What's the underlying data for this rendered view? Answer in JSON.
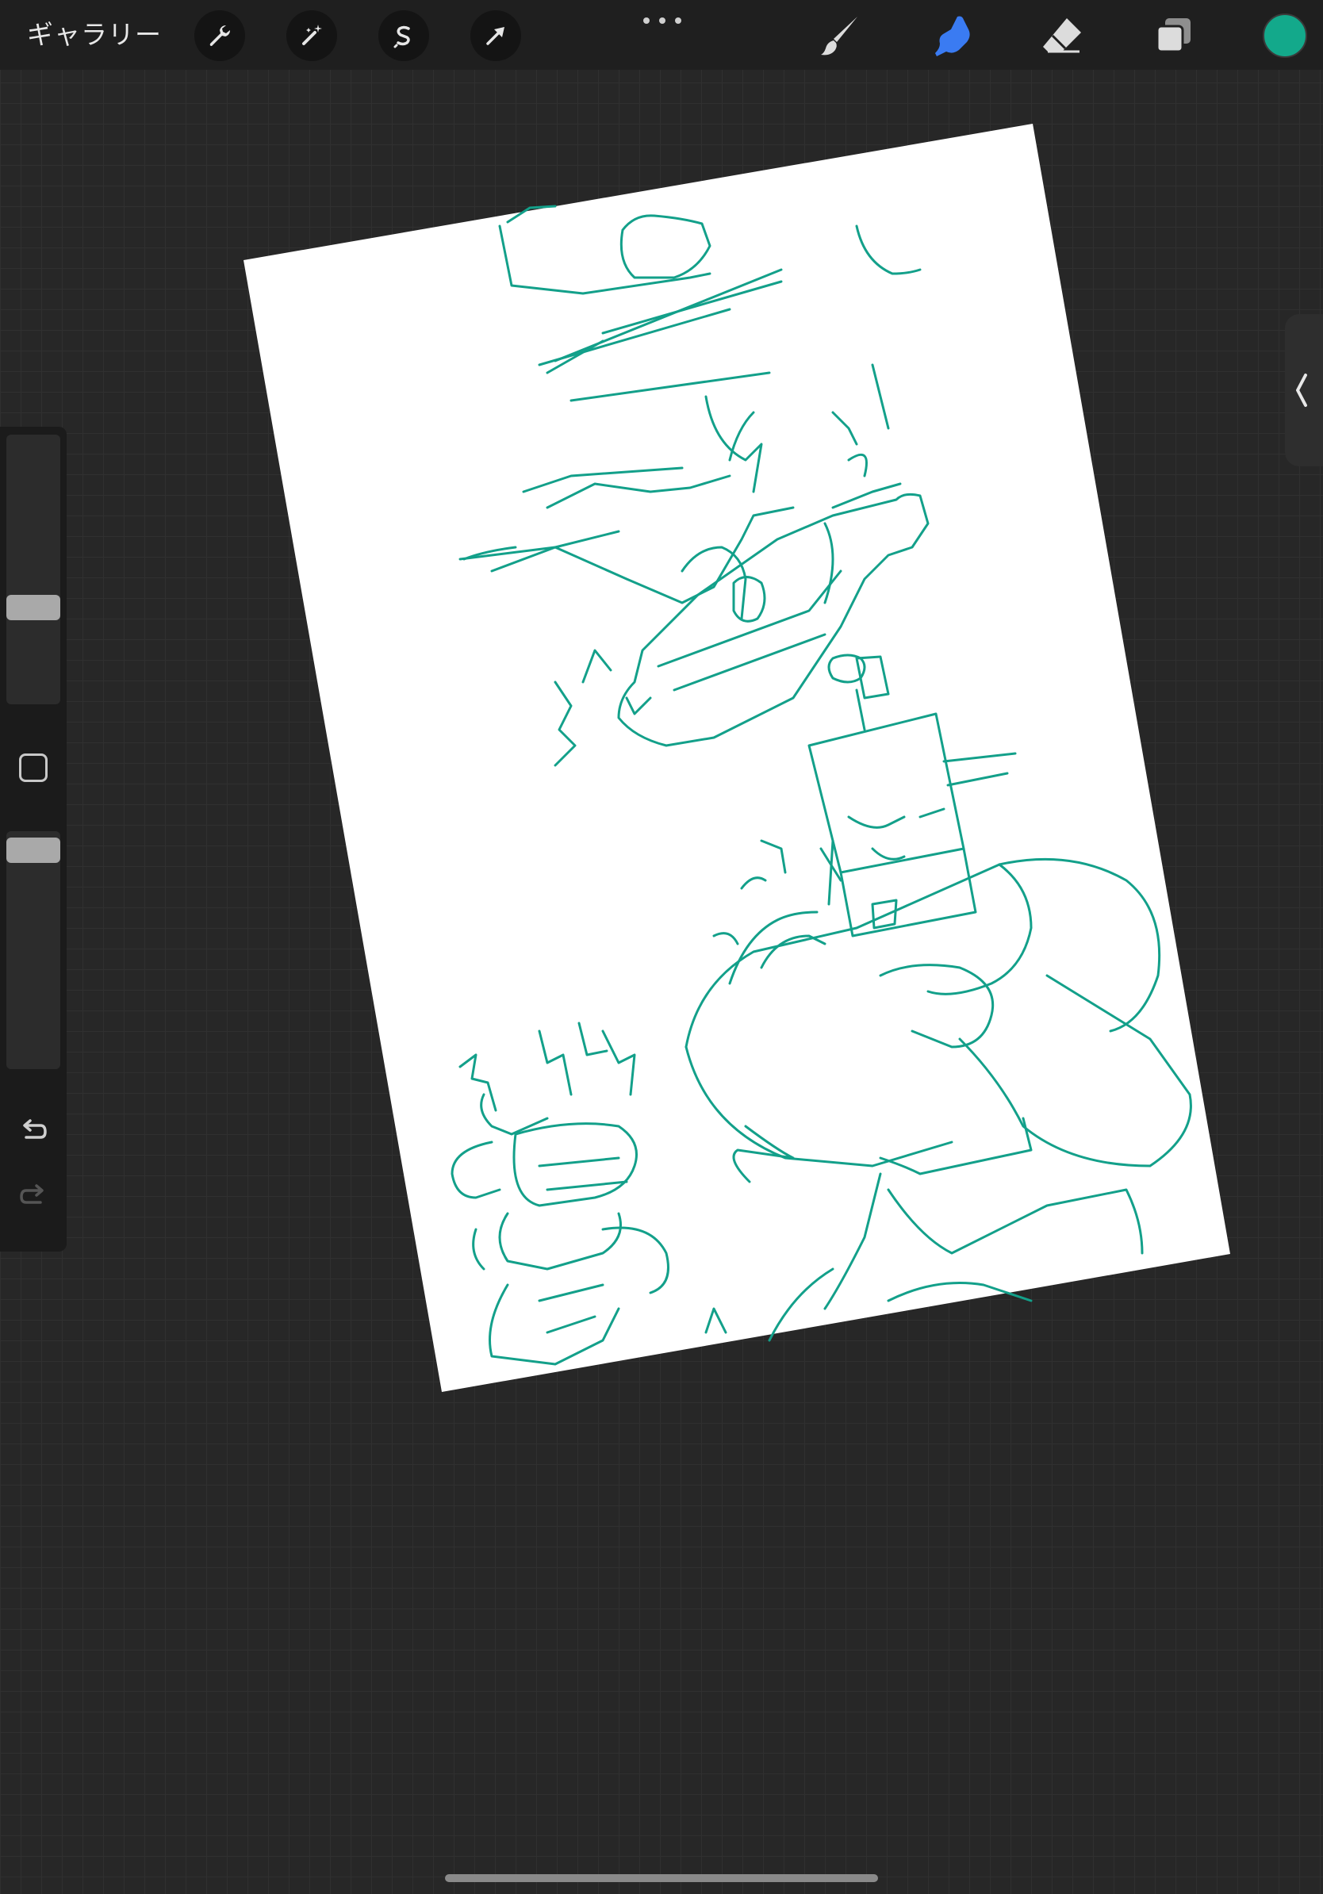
{
  "topbar": {
    "gallery_label": "ギャラリー",
    "actions_icon": "wrench-icon",
    "adjustments_icon": "magic-wand-icon",
    "selection_icon": "selection-s-icon",
    "transform_icon": "transform-arrow-icon",
    "more_icon": "more-dots-icon",
    "brush_icon": "paintbrush-icon",
    "smudge_icon": "smudge-finger-icon",
    "eraser_icon": "eraser-icon",
    "layers_icon": "layers-icon",
    "current_color": "#13a98b",
    "active_tool": "smudge",
    "active_color": "#3a7bf2"
  },
  "sidebar": {
    "brush_size_level": 0.23,
    "opacity_level": 0.0,
    "modifier_icon": "square-modifier-icon",
    "undo_icon": "undo-icon",
    "redo_icon": "redo-icon"
  },
  "right_tab": {
    "icon": "chevron-left-icon"
  },
  "canvas": {
    "paper_color": "#ffffff",
    "sketch_color": "#13a08a",
    "rotation_deg": -8.5
  }
}
